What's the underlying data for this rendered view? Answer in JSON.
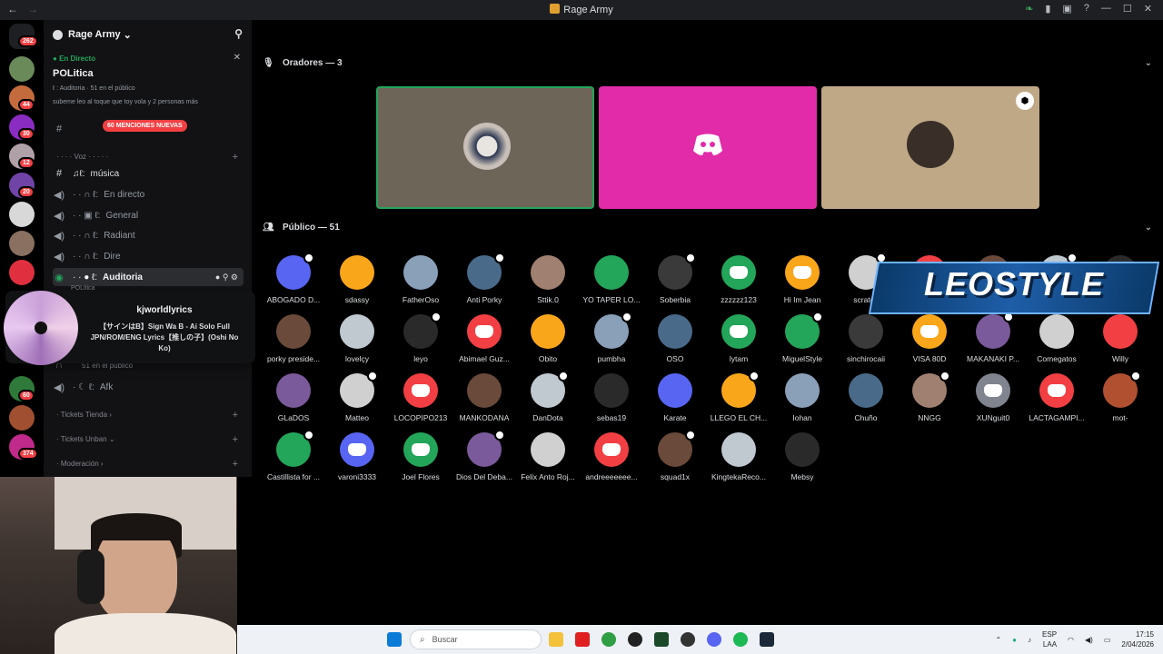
{
  "window": {
    "title": "Rage Army"
  },
  "guild_rail": {
    "badges": [
      "262",
      "44",
      "30",
      "12",
      "20",
      "60",
      "374"
    ]
  },
  "server": {
    "name": "Rage Army"
  },
  "stage": {
    "live_label": "En Directo",
    "name": "POLitica",
    "channel_line": "ℓ : Auditoria",
    "audience_line": "51 en el público",
    "topic": "subeme leo al toque que toy vola y 2 personas más"
  },
  "mentions_badge": "60 MENCIONES NUEVAS",
  "categories": {
    "voice": "Voz",
    "tickets_tienda": "Tickets Tienda",
    "tickets_unban": "Tickets Unban",
    "moderacion": "Moderación"
  },
  "channels": [
    {
      "label": "música"
    },
    {
      "label": "En directo"
    },
    {
      "label": "General"
    },
    {
      "label": "Radiant"
    },
    {
      "label": "Dire"
    },
    {
      "label": "Auditoria",
      "sub": "POLitica"
    },
    {
      "label": "51 en el público"
    },
    {
      "label": "Afk"
    }
  ],
  "activity_popup": {
    "user": "kjworldlyrics",
    "song": "【サインはB】Sign Wa B - Ai Solo Full JPN/ROM/ENG Lyrics【推しの子】(Oshi No Ko)"
  },
  "speakers_header": "Oradores — 3",
  "audience_header": "Público — 51",
  "speaker_tiles": [
    {
      "bg": "#6e6559",
      "avatar": "#c8c0b8"
    },
    {
      "bg": "#e22ba8",
      "avatar": "discord"
    },
    {
      "bg": "#bfa886",
      "avatar": "#3a2e28"
    }
  ],
  "audience": [
    [
      "ABOGADO D...",
      "sdassy",
      "FatherOso",
      "Anti Porky",
      "Sttik.0",
      "YO TAPER LO...",
      "Soberbia",
      "zzzzzz123",
      "Hi Im Jean",
      "scratch",
      "",
      "",
      "",
      ""
    ],
    [
      "porky preside...",
      "lovelçy",
      "leyo",
      "Abimael Guz...",
      "Obito",
      "pumbha",
      "OSO",
      "lytam",
      "MiguelStyle",
      "sinchirocaii",
      "VISA 80D",
      "MAKANAKI P...",
      "Comegatos",
      "Willy"
    ],
    [
      "GLaDOS",
      "Matteo",
      "LOCOPIPO213",
      "MANKODANA",
      "DanDota",
      "sebas19",
      "Karate",
      "LLEGO EL CH...",
      "Iohan",
      "Chuño",
      "NNGG",
      "XUNguit0",
      "LACTAGAMPI...",
      "mot-"
    ],
    [
      "Castillista for ...",
      "varoni3333",
      "Joel Flores",
      "Dios Del Deba...",
      "Felix Anto Roj...",
      "andreeeeeee...",
      "squad1x",
      "KingtekaReco...",
      "Mebsy"
    ]
  ],
  "overlay_text": "LEOSTYLE",
  "taskbar": {
    "search_placeholder": "Buscar",
    "lang": "ESP",
    "lang2": "LAA",
    "time": "17:15",
    "date": "2/04/2026"
  }
}
